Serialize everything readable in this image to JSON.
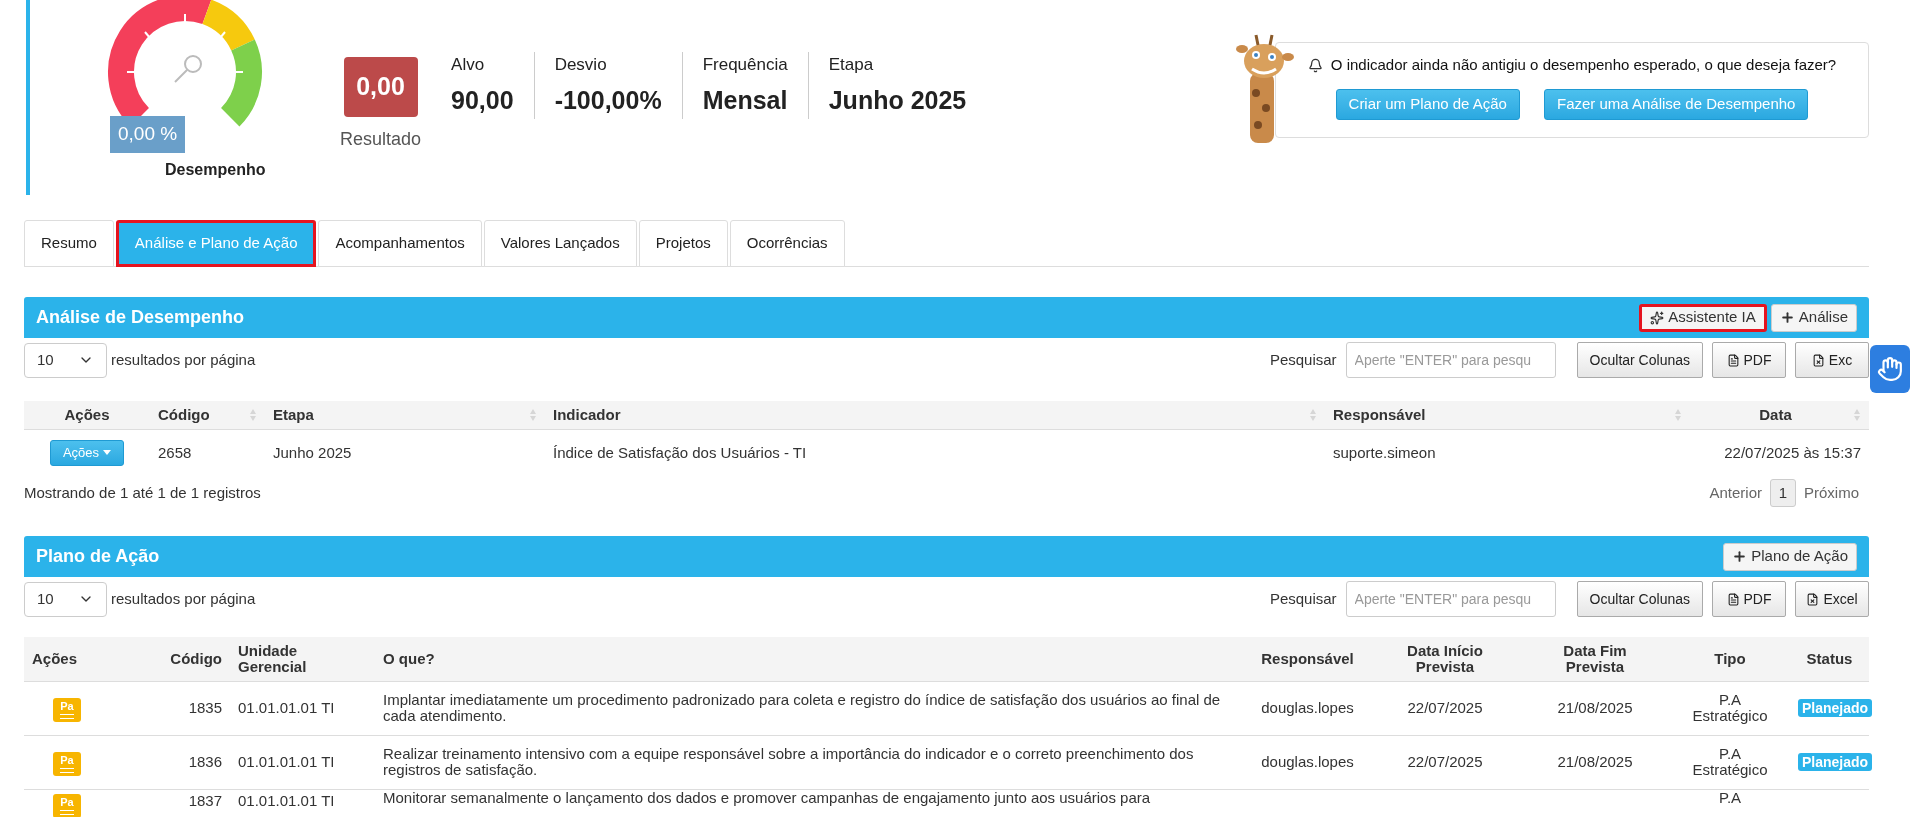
{
  "summary": {
    "gauge": {
      "reading": "0,00 %",
      "label": "Desempenho"
    },
    "result": {
      "value": "0,00",
      "label": "Resultado"
    },
    "stats": [
      {
        "label": "Alvo",
        "value": "90,00"
      },
      {
        "label": "Desvio",
        "value": "-100,00%"
      },
      {
        "label": "Frequência",
        "value": "Mensal"
      },
      {
        "label": "Etapa",
        "value": "Junho 2025"
      }
    ]
  },
  "alert": {
    "message": "O indicador ainda não antigiu o desempenho esperado, o que deseja fazer?",
    "buttons": [
      "Criar um Plano de Ação",
      "Fazer uma Análise de Desempenho"
    ]
  },
  "tabs": [
    {
      "label": "Resumo",
      "selected": false,
      "highlighted": false
    },
    {
      "label": "Análise e Plano de Ação",
      "selected": true,
      "highlighted": true
    },
    {
      "label": "Acompanhamentos",
      "selected": false,
      "highlighted": false
    },
    {
      "label": "Valores Lançados",
      "selected": false,
      "highlighted": false
    },
    {
      "label": "Projetos",
      "selected": false,
      "highlighted": false
    },
    {
      "label": "Ocorrências",
      "selected": false,
      "highlighted": false
    }
  ],
  "analysis": {
    "title": "Análise de Desempenho",
    "buttons": [
      {
        "label": "Assistente IA",
        "highlighted": true
      },
      {
        "label": "Análise",
        "highlighted": false
      }
    ],
    "page_size": "10",
    "page_size_label": "resultados por página",
    "search_label": "Pesquisar",
    "search_placeholder": "Aperte \"ENTER\" para pesqu",
    "tools": [
      "Ocultar Colunas",
      "PDF",
      "Exc"
    ],
    "columns": [
      "Ações",
      "Código",
      "Etapa",
      "Indicador",
      "Responsável",
      "Data"
    ],
    "rows": [
      {
        "action": "Ações",
        "code": "2658",
        "stage": "Junho 2025",
        "indicator": "Índice de Satisfação dos Usuários - TI",
        "owner": "suporte.simeon",
        "date": "22/07/2025 às 15:37"
      }
    ],
    "info": "Mostrando de 1 até 1 de 1 registros",
    "pagination": {
      "previous": "Anterior",
      "pages": [
        {
          "label": "1",
          "selected": true
        }
      ],
      "next": "Próximo"
    }
  },
  "action_plan": {
    "title": "Plano de Ação",
    "buttons": [
      {
        "label": "Plano de Ação",
        "highlighted": false
      }
    ],
    "page_size": "10",
    "page_size_label": "resultados por página",
    "search_label": "Pesquisar",
    "search_placeholder": "Aperte \"ENTER\" para pesqu",
    "tools": [
      "Ocultar Colunas",
      "PDF",
      "Excel"
    ],
    "columns": [
      "Ações",
      "Código",
      "Unidade Gerencial",
      "O que?",
      "Responsável",
      "Data Início Prevista",
      "Data Fim Prevista",
      "Tipo",
      "Status"
    ],
    "rows": [
      {
        "icon": "Pa",
        "code": "1835",
        "unit": "01.01.01.01 TI",
        "what": "Implantar imediatamente um procedimento padronizado para coleta e registro do índice de satisfação dos usuários ao final de cada atendimento.",
        "owner": "douglas.lopes",
        "start": "22/07/2025",
        "end": "21/08/2025",
        "type": "P.A Estratégico",
        "status": "Planejado"
      },
      {
        "icon": "Pa",
        "code": "1836",
        "unit": "01.01.01.01 TI",
        "what": "Realizar treinamento intensivo com a equipe responsável sobre a importância do indicador e o correto preenchimento dos registros de satisfação.",
        "owner": "douglas.lopes",
        "start": "22/07/2025",
        "end": "21/08/2025",
        "type": "P.A Estratégico",
        "status": "Planejado"
      },
      {
        "icon": "Pa",
        "code": "1837",
        "unit": "01.01.01.01 TI",
        "what": "Monitorar semanalmente o lançamento dos dados e promover campanhas de engajamento junto aos usuários para",
        "type": "P.A"
      }
    ]
  }
}
